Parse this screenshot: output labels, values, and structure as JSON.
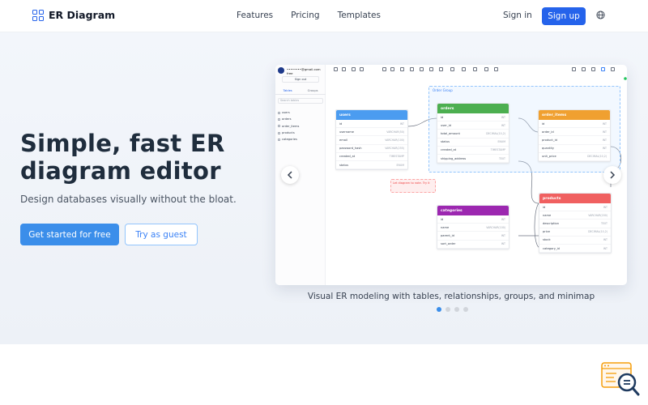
{
  "brand": {
    "name": "ER Diagram"
  },
  "nav": {
    "links": [
      "Features",
      "Pricing",
      "Templates"
    ],
    "signin": "Sign in",
    "signup": "Sign up"
  },
  "hero": {
    "headline": "Simple, fast ER diagram editor",
    "subline": "Design databases visually without the bloat.",
    "cta_primary": "Get started for free",
    "cta_secondary": "Try as guest"
  },
  "preview": {
    "email": "••••••••@gmail.com",
    "plan": "free",
    "sign_out": "Sign out",
    "tabs": [
      "Tables",
      "Groups"
    ],
    "search_placeholder": "Search tables",
    "sidebar_tables": [
      "users",
      "orders",
      "order_items",
      "products",
      "categories"
    ],
    "group_label": "Order Group",
    "note": "Let diagram to note.  Try it",
    "tables": [
      {
        "name": "users",
        "color": "#4b9cf0",
        "rows": [
          [
            "id",
            "INT"
          ],
          [
            "username",
            "VARCHAR(50)"
          ],
          [
            "email",
            "VARCHAR(100)"
          ],
          [
            "password_hash",
            "VARCHAR(255)"
          ],
          [
            "created_at",
            "TIMESTAMP"
          ],
          [
            "status",
            "ENUM"
          ]
        ]
      },
      {
        "name": "orders",
        "color": "#4caf50",
        "rows": [
          [
            "id",
            "INT"
          ],
          [
            "user_id",
            "INT"
          ],
          [
            "total_amount",
            "DECIMAL(10,2)"
          ],
          [
            "status",
            "ENUM"
          ],
          [
            "created_at",
            "TIMESTAMP"
          ],
          [
            "shipping_address",
            "TEXT"
          ]
        ]
      },
      {
        "name": "order_items",
        "color": "#f0a030",
        "rows": [
          [
            "id",
            "INT"
          ],
          [
            "order_id",
            "INT"
          ],
          [
            "product_id",
            "INT"
          ],
          [
            "quantity",
            "INT"
          ],
          [
            "unit_price",
            "DECIMAL(10,2)"
          ]
        ]
      },
      {
        "name": "categories",
        "color": "#9c27b0",
        "rows": [
          [
            "id",
            "INT"
          ],
          [
            "name",
            "VARCHAR(100)"
          ],
          [
            "parent_id",
            "INT"
          ],
          [
            "sort_order",
            "INT"
          ]
        ]
      },
      {
        "name": "products",
        "color": "#f06060",
        "rows": [
          [
            "id",
            "INT"
          ],
          [
            "name",
            "VARCHAR(200)"
          ],
          [
            "description",
            "TEXT"
          ],
          [
            "price",
            "DECIMAL(10,2)"
          ],
          [
            "stock",
            "INT"
          ],
          [
            "category_id",
            "INT"
          ]
        ]
      }
    ],
    "caption": "Visual ER modeling with tables, relationships, groups, and minimap"
  },
  "carousel": {
    "count": 4,
    "active": 0
  },
  "colors": {
    "accent": "#2563eb",
    "primary_button": "#3b8eea"
  }
}
